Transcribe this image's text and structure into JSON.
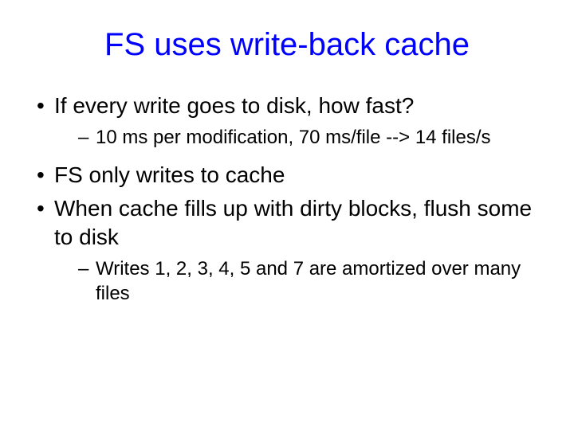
{
  "title": "FS uses write-back cache",
  "bullets": [
    {
      "text": "If every write goes to disk, how fast?",
      "sub": [
        "10 ms per modification, 70 ms/file --> 14 files/s"
      ]
    },
    {
      "text": "FS only writes to cache",
      "sub": []
    },
    {
      "text": "When cache fills up with dirty blocks, flush some to disk",
      "sub": [
        "Writes 1, 2, 3, 4, 5 and 7 are amortized over many files"
      ]
    }
  ]
}
